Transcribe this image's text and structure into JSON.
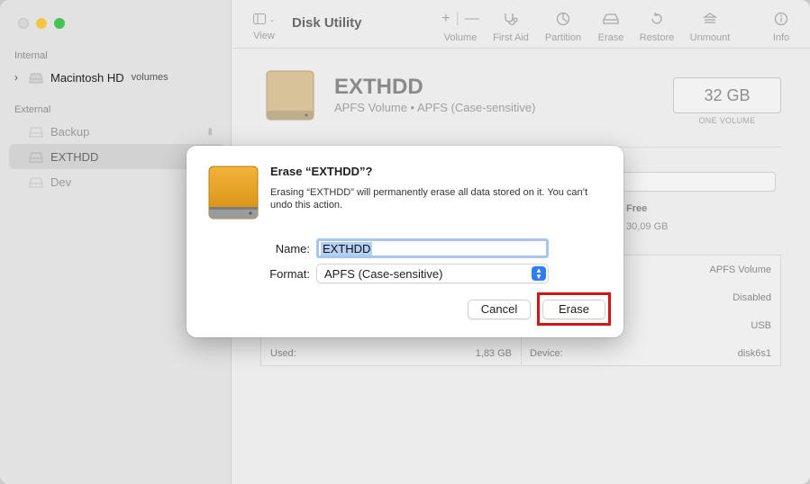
{
  "app": {
    "title": "Disk Utility"
  },
  "toolbar": {
    "view": "View",
    "volume": "Volume",
    "first_aid": "First Aid",
    "partition": "Partition",
    "erase": "Erase",
    "restore": "Restore",
    "unmount": "Unmount",
    "info": "Info",
    "volume_add": "+",
    "volume_remove": "—"
  },
  "sidebar": {
    "internal_label": "Internal",
    "external_label": "External",
    "internal_items": [
      {
        "label": "Macintosh HD",
        "sub": "volumes"
      }
    ],
    "external_items": [
      {
        "label": "Backup"
      },
      {
        "label": "EXTHDD"
      },
      {
        "label": "Dev"
      }
    ]
  },
  "volume": {
    "name": "EXTHDD",
    "subtitle": "APFS Volume • APFS (Case-sensitive)",
    "capacity": "32 GB",
    "capacity_sub": "ONE VOLUME",
    "free_label": "Free",
    "free_value": "30,09 GB"
  },
  "info": {
    "type_value": "APFS Volume",
    "owners_value": "Disabled",
    "connection_value": "USB",
    "used_label": "Used:",
    "used_value": "1,83 GB",
    "device_label": "Device:",
    "device_value": "disk6s1"
  },
  "dialog": {
    "title": "Erase “EXTHDD”?",
    "message": "Erasing “EXTHDD” will permanently erase all data stored on it. You can’t undo this action.",
    "name_label": "Name:",
    "name_value": "EXTHDD",
    "format_label": "Format:",
    "format_value": "APFS (Case-sensitive)",
    "cancel": "Cancel",
    "erase": "Erase"
  },
  "colors": {
    "accent": "#2f7cf6",
    "highlight": "#d11515",
    "drive": "#d9a227"
  }
}
